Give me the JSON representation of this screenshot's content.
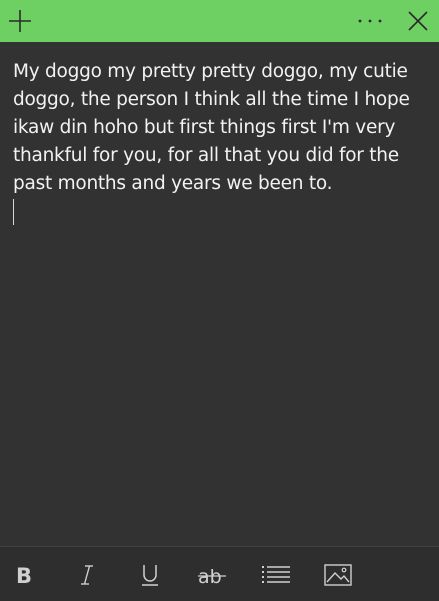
{
  "titlebar": {
    "background_color": "#6ed063",
    "add_icon": "plus-icon",
    "menu_icon": "more-horizontal-icon",
    "close_icon": "close-icon"
  },
  "note": {
    "background_color": "#323232",
    "text": "My doggo my pretty pretty doggo, my cutie doggo, the person I think all the time I hope ikaw din hoho but first things first I'm very thankful for you, for all that you did for the past months and years we been to.",
    "text_color": "#f2f2f2"
  },
  "toolbar": {
    "buttons": [
      {
        "name": "bold",
        "icon": "bold-icon"
      },
      {
        "name": "italic",
        "icon": "italic-icon"
      },
      {
        "name": "underline",
        "icon": "underline-icon"
      },
      {
        "name": "strikethrough",
        "icon": "strikethrough-icon"
      },
      {
        "name": "bullet-list",
        "icon": "list-icon"
      },
      {
        "name": "insert-image",
        "icon": "image-icon"
      }
    ],
    "icon_color": "#d0d0d0"
  }
}
